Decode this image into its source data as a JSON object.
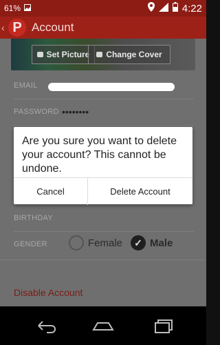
{
  "status": {
    "battery": "61%",
    "time": "4:22"
  },
  "actionbar": {
    "logo": "P",
    "title": "Account"
  },
  "cover": {
    "set_picture": "Set Picture",
    "change_cover": "Change Cover"
  },
  "fields": {
    "email_label": "EMAIL",
    "password_label": "PASSWORD",
    "password_value": "••••••••",
    "birthday_label": "BIRTHDAY",
    "gender_label": "GENDER",
    "gender_options": [
      "Female",
      "Male"
    ],
    "gender_selected": "Male"
  },
  "disable_label": "Disable Account",
  "dialog": {
    "message": "Are you sure you want to delete your account? This cannot be undone.",
    "cancel": "Cancel",
    "delete": "Delete Account"
  },
  "colors": {
    "accent": "#9e2118",
    "danger_text": "#7a1c16"
  }
}
